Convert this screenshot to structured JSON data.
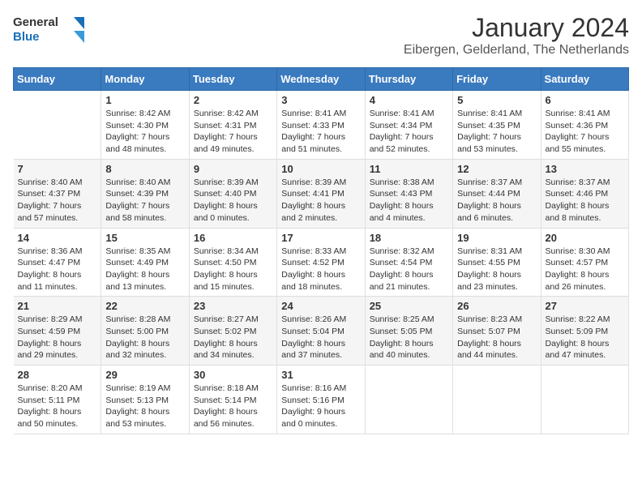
{
  "header": {
    "logo_line1": "General",
    "logo_line2": "Blue",
    "title": "January 2024",
    "subtitle": "Eibergen, Gelderland, The Netherlands"
  },
  "columns": [
    "Sunday",
    "Monday",
    "Tuesday",
    "Wednesday",
    "Thursday",
    "Friday",
    "Saturday"
  ],
  "weeks": [
    [
      {
        "day": "",
        "detail": ""
      },
      {
        "day": "1",
        "detail": "Sunrise: 8:42 AM\nSunset: 4:30 PM\nDaylight: 7 hours\nand 48 minutes."
      },
      {
        "day": "2",
        "detail": "Sunrise: 8:42 AM\nSunset: 4:31 PM\nDaylight: 7 hours\nand 49 minutes."
      },
      {
        "day": "3",
        "detail": "Sunrise: 8:41 AM\nSunset: 4:33 PM\nDaylight: 7 hours\nand 51 minutes."
      },
      {
        "day": "4",
        "detail": "Sunrise: 8:41 AM\nSunset: 4:34 PM\nDaylight: 7 hours\nand 52 minutes."
      },
      {
        "day": "5",
        "detail": "Sunrise: 8:41 AM\nSunset: 4:35 PM\nDaylight: 7 hours\nand 53 minutes."
      },
      {
        "day": "6",
        "detail": "Sunrise: 8:41 AM\nSunset: 4:36 PM\nDaylight: 7 hours\nand 55 minutes."
      }
    ],
    [
      {
        "day": "7",
        "detail": "Sunrise: 8:40 AM\nSunset: 4:37 PM\nDaylight: 7 hours\nand 57 minutes."
      },
      {
        "day": "8",
        "detail": "Sunrise: 8:40 AM\nSunset: 4:39 PM\nDaylight: 7 hours\nand 58 minutes."
      },
      {
        "day": "9",
        "detail": "Sunrise: 8:39 AM\nSunset: 4:40 PM\nDaylight: 8 hours\nand 0 minutes."
      },
      {
        "day": "10",
        "detail": "Sunrise: 8:39 AM\nSunset: 4:41 PM\nDaylight: 8 hours\nand 2 minutes."
      },
      {
        "day": "11",
        "detail": "Sunrise: 8:38 AM\nSunset: 4:43 PM\nDaylight: 8 hours\nand 4 minutes."
      },
      {
        "day": "12",
        "detail": "Sunrise: 8:37 AM\nSunset: 4:44 PM\nDaylight: 8 hours\nand 6 minutes."
      },
      {
        "day": "13",
        "detail": "Sunrise: 8:37 AM\nSunset: 4:46 PM\nDaylight: 8 hours\nand 8 minutes."
      }
    ],
    [
      {
        "day": "14",
        "detail": "Sunrise: 8:36 AM\nSunset: 4:47 PM\nDaylight: 8 hours\nand 11 minutes."
      },
      {
        "day": "15",
        "detail": "Sunrise: 8:35 AM\nSunset: 4:49 PM\nDaylight: 8 hours\nand 13 minutes."
      },
      {
        "day": "16",
        "detail": "Sunrise: 8:34 AM\nSunset: 4:50 PM\nDaylight: 8 hours\nand 15 minutes."
      },
      {
        "day": "17",
        "detail": "Sunrise: 8:33 AM\nSunset: 4:52 PM\nDaylight: 8 hours\nand 18 minutes."
      },
      {
        "day": "18",
        "detail": "Sunrise: 8:32 AM\nSunset: 4:54 PM\nDaylight: 8 hours\nand 21 minutes."
      },
      {
        "day": "19",
        "detail": "Sunrise: 8:31 AM\nSunset: 4:55 PM\nDaylight: 8 hours\nand 23 minutes."
      },
      {
        "day": "20",
        "detail": "Sunrise: 8:30 AM\nSunset: 4:57 PM\nDaylight: 8 hours\nand 26 minutes."
      }
    ],
    [
      {
        "day": "21",
        "detail": "Sunrise: 8:29 AM\nSunset: 4:59 PM\nDaylight: 8 hours\nand 29 minutes."
      },
      {
        "day": "22",
        "detail": "Sunrise: 8:28 AM\nSunset: 5:00 PM\nDaylight: 8 hours\nand 32 minutes."
      },
      {
        "day": "23",
        "detail": "Sunrise: 8:27 AM\nSunset: 5:02 PM\nDaylight: 8 hours\nand 34 minutes."
      },
      {
        "day": "24",
        "detail": "Sunrise: 8:26 AM\nSunset: 5:04 PM\nDaylight: 8 hours\nand 37 minutes."
      },
      {
        "day": "25",
        "detail": "Sunrise: 8:25 AM\nSunset: 5:05 PM\nDaylight: 8 hours\nand 40 minutes."
      },
      {
        "day": "26",
        "detail": "Sunrise: 8:23 AM\nSunset: 5:07 PM\nDaylight: 8 hours\nand 44 minutes."
      },
      {
        "day": "27",
        "detail": "Sunrise: 8:22 AM\nSunset: 5:09 PM\nDaylight: 8 hours\nand 47 minutes."
      }
    ],
    [
      {
        "day": "28",
        "detail": "Sunrise: 8:20 AM\nSunset: 5:11 PM\nDaylight: 8 hours\nand 50 minutes."
      },
      {
        "day": "29",
        "detail": "Sunrise: 8:19 AM\nSunset: 5:13 PM\nDaylight: 8 hours\nand 53 minutes."
      },
      {
        "day": "30",
        "detail": "Sunrise: 8:18 AM\nSunset: 5:14 PM\nDaylight: 8 hours\nand 56 minutes."
      },
      {
        "day": "31",
        "detail": "Sunrise: 8:16 AM\nSunset: 5:16 PM\nDaylight: 9 hours\nand 0 minutes."
      },
      {
        "day": "",
        "detail": ""
      },
      {
        "day": "",
        "detail": ""
      },
      {
        "day": "",
        "detail": ""
      }
    ]
  ]
}
